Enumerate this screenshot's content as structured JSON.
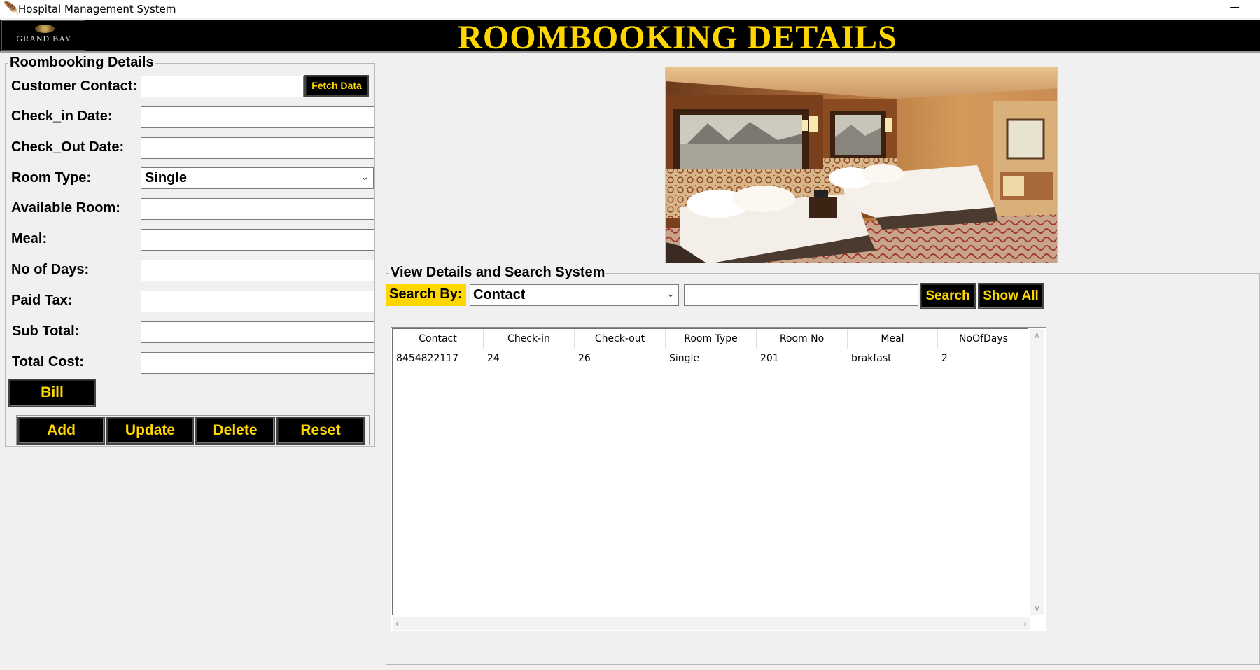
{
  "window": {
    "title": "Hospital Management System",
    "minimize_glyph": "─",
    "app_icon": "feather-icon"
  },
  "header": {
    "logo_text": "GRAND BAY",
    "title": "ROOMBOOKING DETAILS",
    "accent_color": "#FFD700",
    "background_color": "#000000"
  },
  "form": {
    "legend": "Roombooking Details",
    "labels": {
      "customer_contact": "Customer Contact:",
      "check_in": "Check_in Date:",
      "check_out": "Check_Out Date:",
      "room_type": "Room Type:",
      "available_room": "Available Room:",
      "meal": "Meal:",
      "no_of_days": "No of Days:",
      "paid_tax": "Paid Tax:",
      "sub_total": "Sub Total:",
      "total_cost": "Total Cost:"
    },
    "values": {
      "customer_contact": "",
      "check_in": "",
      "check_out": "",
      "room_type": "Single",
      "available_room": "",
      "meal": "",
      "no_of_days": "",
      "paid_tax": "",
      "sub_total": "",
      "total_cost": ""
    },
    "fetch_button": "Fetch Data",
    "bill_button": "Bill",
    "actions": {
      "add": "Add",
      "update": "Update",
      "delete": "Delete",
      "reset": "Reset"
    }
  },
  "search": {
    "legend": "View Details and Search System",
    "label": "Search By:",
    "selected": "Contact",
    "query": "",
    "search_button": "Search",
    "show_all_button": "Show All"
  },
  "table": {
    "columns": [
      "Contact",
      "Check-in",
      "Check-out",
      "Room Type",
      "Room No",
      "Meal",
      "NoOfDays"
    ],
    "rows": [
      [
        "8454822117",
        "24",
        "26",
        "Single",
        "201",
        "brakfast",
        "2"
      ]
    ]
  }
}
